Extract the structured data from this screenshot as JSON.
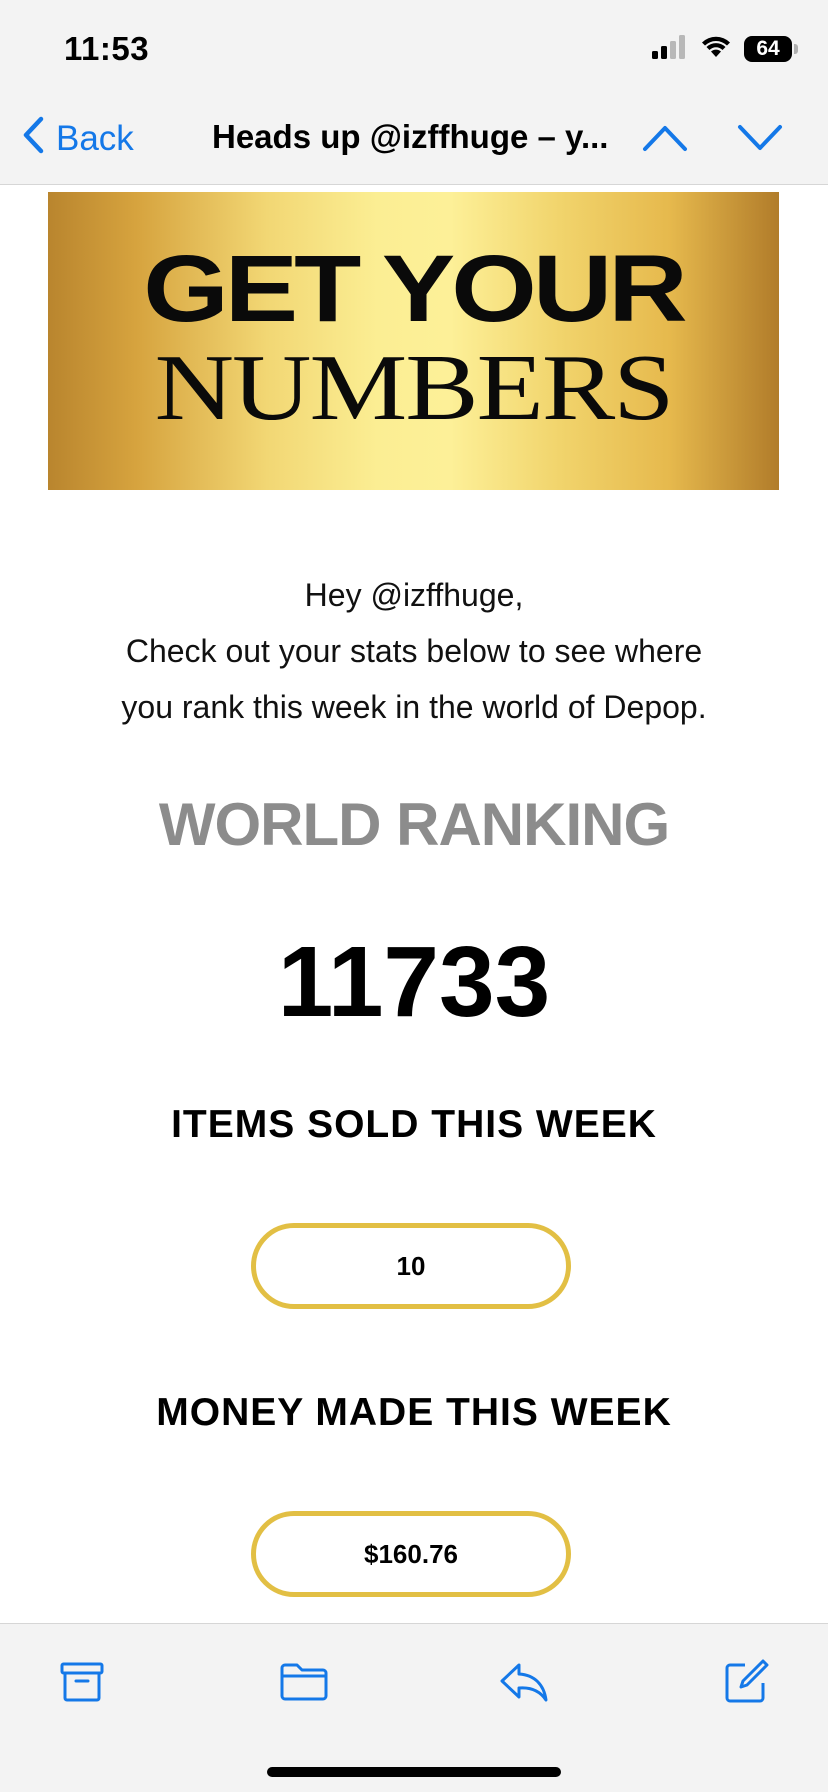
{
  "status_bar": {
    "time": "11:53",
    "battery_level": "64",
    "signal_icon": "cellular-signal-icon",
    "wifi_icon": "wifi-icon"
  },
  "nav": {
    "back_label": "Back",
    "title": "Heads up @izffhuge – y...",
    "back_icon": "chevron-left-icon",
    "prev_icon": "chevron-up-icon",
    "next_icon": "chevron-down-icon",
    "accent_color": "#1478e8"
  },
  "email": {
    "banner": {
      "line1": "GET YOUR",
      "line2": "NUMBERS"
    },
    "greeting": {
      "line1": "Hey @izffhuge,",
      "line2": "Check out your stats below to see where",
      "line3": "you rank this week in the world of Depop."
    },
    "ranking": {
      "label": "WORLD RANKING",
      "value": "11733"
    },
    "items_sold": {
      "heading": "ITEMS SOLD THIS WEEK",
      "value": "10"
    },
    "money_made": {
      "heading": "MONEY MADE THIS WEEK",
      "value": "$160.76"
    },
    "pill_border_color": "#e2bf44"
  },
  "toolbar": {
    "archive_icon": "archive-icon",
    "folder_icon": "folder-icon",
    "reply_icon": "reply-icon",
    "compose_icon": "compose-icon"
  }
}
